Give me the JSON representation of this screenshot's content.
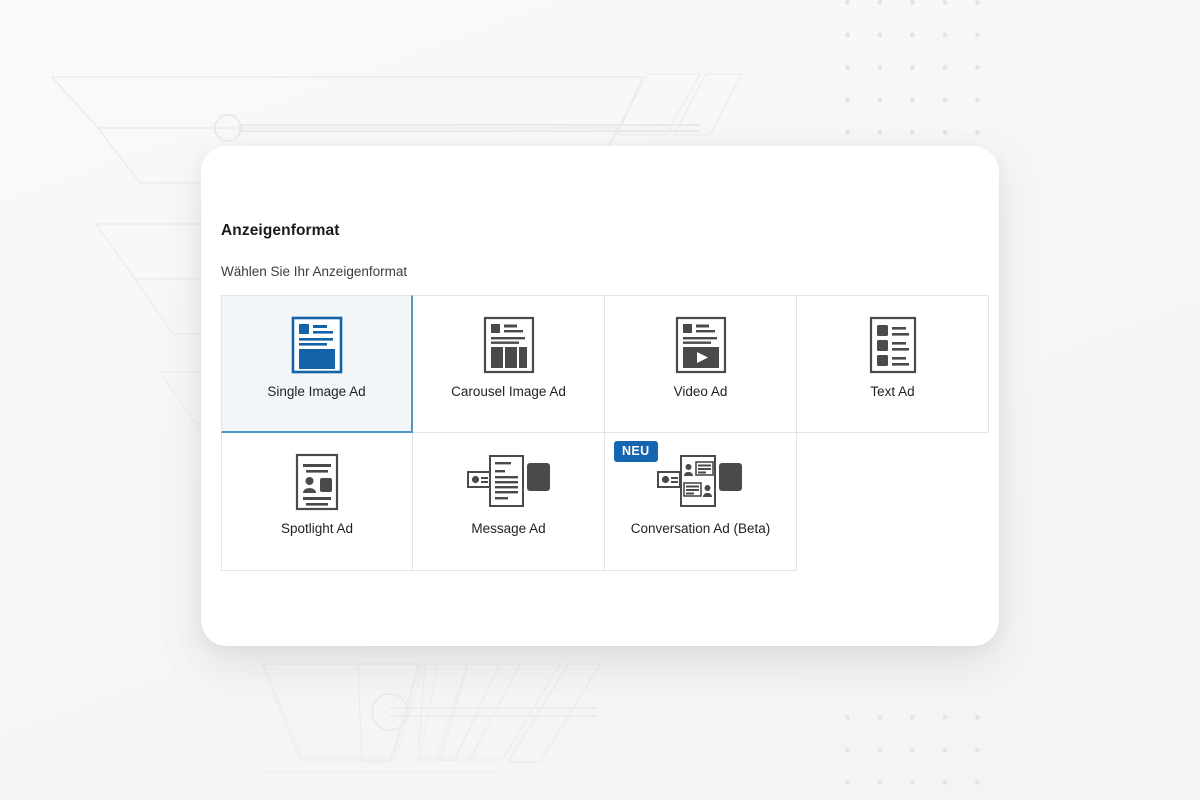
{
  "panel": {
    "title": "Anzeigenformat",
    "subtitle": "Wählen Sie Ihr Anzeigenformat"
  },
  "colors": {
    "accent_blue": "#1462A8",
    "badge_blue": "#1565b0",
    "selected_border": "#4f97c4",
    "selected_fill": "#f2f6f9",
    "icon_grey": "#4a4a4a",
    "grid_line": "#e4e4e4",
    "page_background": "#f7f7f7"
  },
  "formats": [
    {
      "id": "single-image-ad",
      "label": "Single Image Ad",
      "icon": "single-image-ad-icon",
      "selected": true,
      "badge": null
    },
    {
      "id": "carousel-image-ad",
      "label": "Carousel Image Ad",
      "icon": "carousel-image-ad-icon",
      "selected": false,
      "badge": null
    },
    {
      "id": "video-ad",
      "label": "Video Ad",
      "icon": "video-ad-icon",
      "selected": false,
      "badge": null
    },
    {
      "id": "text-ad",
      "label": "Text Ad",
      "icon": "text-ad-icon",
      "selected": false,
      "badge": null
    },
    {
      "id": "spotlight-ad",
      "label": "Spotlight Ad",
      "icon": "spotlight-ad-icon",
      "selected": false,
      "badge": null
    },
    {
      "id": "message-ad",
      "label": "Message Ad",
      "icon": "message-ad-icon",
      "selected": false,
      "badge": null
    },
    {
      "id": "conversation-ad",
      "label": "Conversation Ad (Beta)",
      "icon": "conversation-ad-icon",
      "selected": false,
      "badge": "NEU"
    }
  ]
}
